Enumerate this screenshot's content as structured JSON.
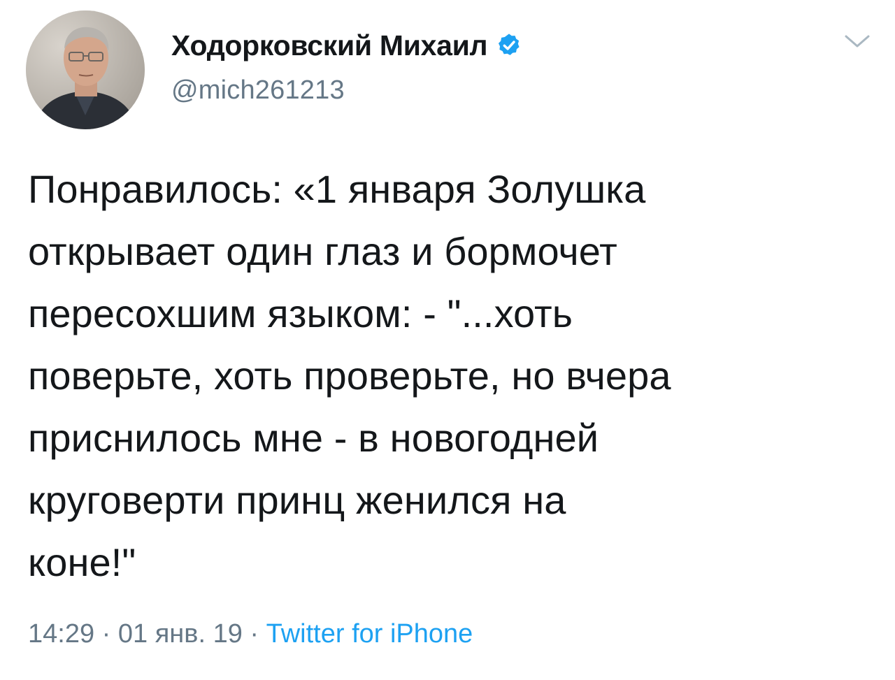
{
  "author": {
    "display_name": "Ходорковский Михаил",
    "handle": "@mich261213",
    "verified": true,
    "avatar_icon": "profile-photo"
  },
  "tweet": {
    "text": "Понравилось: «1 января Золушка\nоткрывает один глаз и бормочет\nпересохшим языком: - \"...хоть\nповерьте, хоть проверьте, но вчера\nприснилось мне - в новогодней\nкруговерти принц женился на\nконе!\""
  },
  "meta": {
    "time": "14:29",
    "separator_1": " · ",
    "date": "01 янв. 19",
    "separator_2": " · ",
    "source": "Twitter for iPhone"
  },
  "colors": {
    "text": "#14171a",
    "secondary": "#657786",
    "link": "#1da1f2",
    "verified": "#1da1f2",
    "caret": "#aab8c2"
  },
  "icons": {
    "verified": "verified-badge-icon",
    "menu": "chevron-down-icon"
  }
}
